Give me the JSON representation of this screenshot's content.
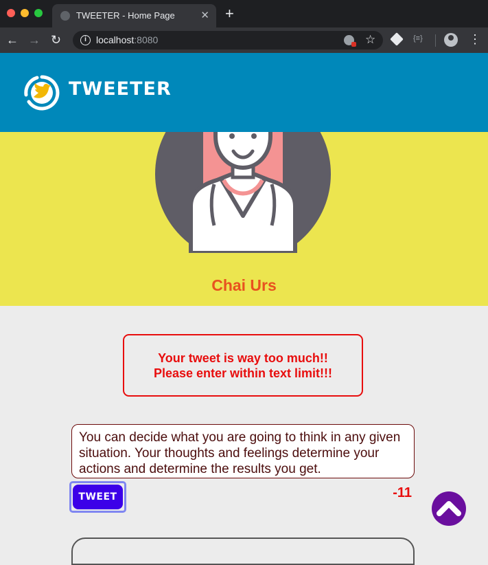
{
  "browser": {
    "tab_title": "TWEETER - Home Page",
    "tab_close": "✕",
    "new_tab": "+",
    "url_host": "localhost",
    "url_port": ":8080",
    "ext2_label": "{≡}",
    "menu": "⋮"
  },
  "header": {
    "brand": "TWEETER"
  },
  "profile": {
    "name": "Chai Urs"
  },
  "alert": {
    "line1": "Your tweet is way too much!!",
    "line2": "Please enter within text limit!!!"
  },
  "composer": {
    "text": "You can decide what you are going to think in any given situation. Your thoughts and feelings determine your actions and determine the results you get.",
    "button_label": "TWEET",
    "counter": "-11"
  },
  "colors": {
    "header_bg": "#0088ba",
    "banner_bg": "#ece54f",
    "name": "#e8521f",
    "error": "#e80d0d",
    "tweet_button": "#3c00e8",
    "scroll_top": "#6a0f9e"
  }
}
